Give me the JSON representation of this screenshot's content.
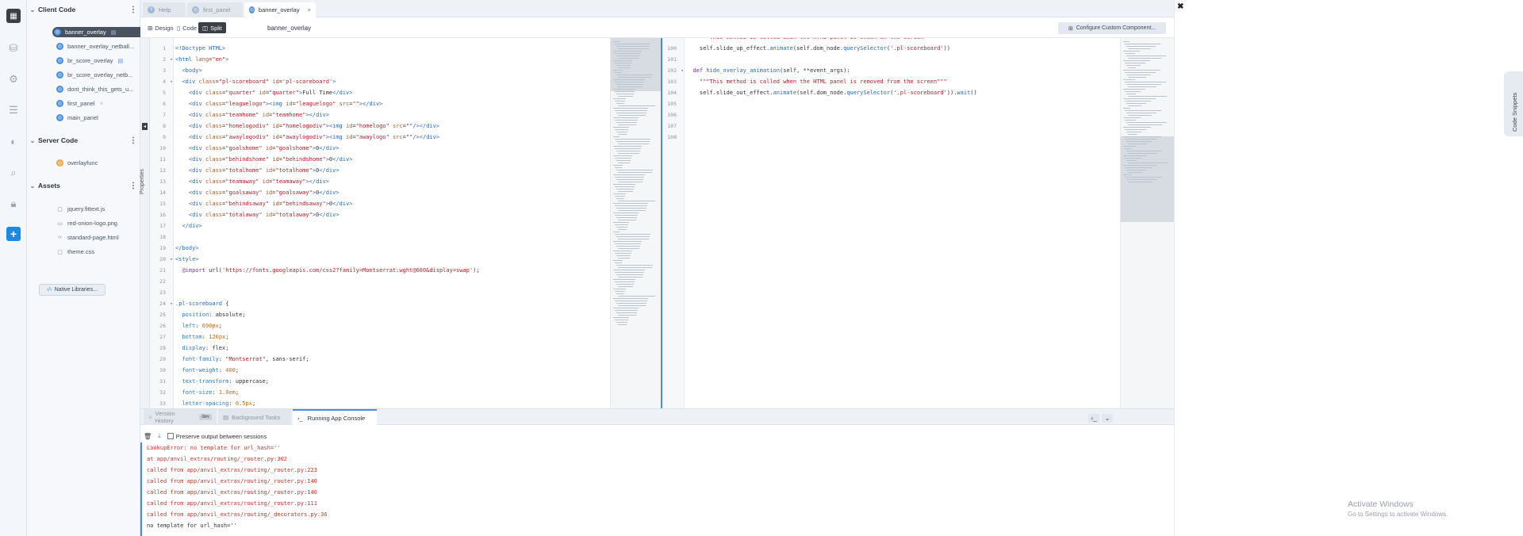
{
  "sidebar": {
    "client_code": {
      "title": "Client Code",
      "items": [
        {
          "label": "banner_overlay",
          "active": true
        },
        {
          "label": "banner_overlay_netball..."
        },
        {
          "label": "br_score_overlay"
        },
        {
          "label": "br_score_overlay_netb..."
        },
        {
          "label": "dont_think_this_gets_u..."
        },
        {
          "label": "first_panel"
        },
        {
          "label": "main_panel"
        }
      ]
    },
    "server_code": {
      "title": "Server Code",
      "items": [
        {
          "label": "overlayfunc"
        }
      ]
    },
    "assets": {
      "title": "Assets",
      "items": [
        {
          "label": "jquery.fittext.js"
        },
        {
          "label": "red-onion-logo.png"
        },
        {
          "label": "standard-page.html"
        },
        {
          "label": "theme.css"
        }
      ]
    },
    "native_libraries_label": "Native Libraries..."
  },
  "tabs": [
    {
      "label": "Help"
    },
    {
      "label": "first_panel"
    },
    {
      "label": "banner_overlay",
      "active": true
    }
  ],
  "toolbar": {
    "design_label": "Design",
    "code_label": "Code",
    "split_label": "Split",
    "file_name": "banner_overlay",
    "configure_label": "Configure Custom Component...",
    "properties_label": "Properties"
  },
  "html_editor": {
    "lines": [
      {
        "n": "1",
        "fold": "",
        "html": "<span class=\"t\">&lt;!Doctype HTML&gt;</span>"
      },
      {
        "n": "2",
        "fold": "▾",
        "html": "<span class=\"t\">&lt;html</span> <span class=\"a\">lang</span>=<span class=\"s\">\"en\"</span><span class=\"t\">&gt;</span>"
      },
      {
        "n": "3",
        "fold": "",
        "html": "  <span class=\"t\">&lt;body&gt;</span>"
      },
      {
        "n": "4",
        "fold": "▾",
        "html": "  <span class=\"t\">&lt;div</span> <span class=\"a\">class</span>=<span class=\"s\">\"pl-scoreboard\"</span> <span class=\"a\">id</span>=<span class=\"s\">'pl-scoreboard'</span><span class=\"t\">&gt;</span>"
      },
      {
        "n": "5",
        "fold": "",
        "html": "    <span class=\"t\">&lt;div</span> <span class=\"a\">class</span>=<span class=\"s\">\"quarter\"</span> <span class=\"a\">id</span>=<span class=\"s\">\"quarter\"</span><span class=\"t\">&gt;</span>Full Time<span class=\"t\">&lt;/div&gt;</span>"
      },
      {
        "n": "6",
        "fold": "",
        "html": "    <span class=\"t\">&lt;div</span> <span class=\"a\">class</span>=<span class=\"s\">\"leaguelogo\"</span><span class=\"t\">&gt;&lt;img</span> <span class=\"a\">id</span>=<span class=\"s\">\"leaguelogo\"</span> <span class=\"a\">src</span>=<span class=\"s\">\"\"</span><span class=\"t\">&gt;&lt;/div&gt;</span>"
      },
      {
        "n": "7",
        "fold": "",
        "html": "    <span class=\"t\">&lt;div</span> <span class=\"a\">class</span>=<span class=\"s\">\"teamhome\"</span> <span class=\"a\">id</span>=<span class=\"s\">\"teamhome\"</span><span class=\"t\">&gt;&lt;/div&gt;</span>"
      },
      {
        "n": "8",
        "fold": "",
        "html": "    <span class=\"t\">&lt;div</span> <span class=\"a\">class</span>=<span class=\"s\">\"homelogodiv\"</span> <span class=\"a\">id</span>=<span class=\"s\">\"homelogodiv\"</span><span class=\"t\">&gt;&lt;img</span> <span class=\"a\">id</span>=<span class=\"s\">\"homelogo\"</span> <span class=\"a\">src</span>=<span class=\"s\">\"\"</span><span class=\"t\">/&gt;&lt;/div&gt;</span>"
      },
      {
        "n": "9",
        "fold": "",
        "html": "    <span class=\"t\">&lt;div</span> <span class=\"a\">class</span>=<span class=\"s\">\"awaylogodiv\"</span> <span class=\"a\">id</span>=<span class=\"s\">\"awaylogodiv\"</span><span class=\"t\">&gt;&lt;img</span> <span class=\"a\">id</span>=<span class=\"s\">\"awaylogo\"</span> <span class=\"a\">src</span>=<span class=\"s\">\"\"</span><span class=\"t\">/&gt;&lt;/div&gt;</span>"
      },
      {
        "n": "10",
        "fold": "",
        "html": "    <span class=\"t\">&lt;div</span> <span class=\"a\">class</span>=<span class=\"s\">\"goalshome\"</span> <span class=\"a\">id</span>=<span class=\"s\">\"goalshome\"</span><span class=\"t\">&gt;</span>0<span class=\"t\">&lt;/div&gt;</span>"
      },
      {
        "n": "11",
        "fold": "",
        "html": "    <span class=\"t\">&lt;div</span> <span class=\"a\">class</span>=<span class=\"s\">\"behindshome\"</span> <span class=\"a\">id</span>=<span class=\"s\">\"behindshome\"</span><span class=\"t\">&gt;</span>0<span class=\"t\">&lt;/div&gt;</span>"
      },
      {
        "n": "12",
        "fold": "",
        "html": "    <span class=\"t\">&lt;div</span> <span class=\"a\">class</span>=<span class=\"s\">\"totalhome\"</span> <span class=\"a\">id</span>=<span class=\"s\">\"totalhome\"</span><span class=\"t\">&gt;</span>0<span class=\"t\">&lt;/div&gt;</span>"
      },
      {
        "n": "13",
        "fold": "",
        "html": "    <span class=\"t\">&lt;div</span> <span class=\"a\">class</span>=<span class=\"s\">\"teamaway\"</span> <span class=\"a\">id</span>=<span class=\"s\">\"teamaway\"</span><span class=\"t\">&gt;&lt;/div&gt;</span>"
      },
      {
        "n": "14",
        "fold": "",
        "html": "    <span class=\"t\">&lt;div</span> <span class=\"a\">class</span>=<span class=\"s\">\"goalsaway\"</span> <span class=\"a\">id</span>=<span class=\"s\">\"goalsaway\"</span><span class=\"t\">&gt;</span>0<span class=\"t\">&lt;/div&gt;</span>"
      },
      {
        "n": "15",
        "fold": "",
        "html": "    <span class=\"t\">&lt;div</span> <span class=\"a\">class</span>=<span class=\"s\">\"behindsaway\"</span> <span class=\"a\">id</span>=<span class=\"s\">\"behindsaway\"</span><span class=\"t\">&gt;</span>0<span class=\"t\">&lt;/div&gt;</span>"
      },
      {
        "n": "16",
        "fold": "",
        "html": "    <span class=\"t\">&lt;div</span> <span class=\"a\">class</span>=<span class=\"s\">\"totalaway\"</span> <span class=\"a\">id</span>=<span class=\"s\">\"totalaway\"</span><span class=\"t\">&gt;</span>0<span class=\"t\">&lt;/div&gt;</span>"
      },
      {
        "n": "17",
        "fold": "",
        "html": "  <span class=\"t\">&lt;/div&gt;</span>"
      },
      {
        "n": "18",
        "fold": "",
        "html": ""
      },
      {
        "n": "19",
        "fold": "",
        "html": "<span class=\"t\">&lt;/body&gt;</span>"
      },
      {
        "n": "20",
        "fold": "▾",
        "html": "<span class=\"t\">&lt;style&gt;</span>"
      },
      {
        "n": "21",
        "fold": "",
        "html": "  <span class=\"k\">@import</span> url(<span class=\"s\">'https://fonts.googleapis.com/css2?family=Montserrat:wght@600&amp;display=swap'</span>);"
      },
      {
        "n": "22",
        "fold": "",
        "html": ""
      },
      {
        "n": "23",
        "fold": "",
        "html": ""
      },
      {
        "n": "24",
        "fold": "▾",
        "html": "<span class=\"t\">.pl-scoreboard</span> {"
      },
      {
        "n": "25",
        "fold": "",
        "html": "  <span class=\"p\">position</span>: absolute;"
      },
      {
        "n": "26",
        "fold": "",
        "html": "  <span class=\"p\">left</span>: <span class=\"n\">690px</span>;"
      },
      {
        "n": "27",
        "fold": "",
        "html": "  <span class=\"p\">bottom</span>: <span class=\"n\">126px</span>;"
      },
      {
        "n": "28",
        "fold": "",
        "html": "  <span class=\"p\">display</span>: flex;"
      },
      {
        "n": "29",
        "fold": "",
        "html": "  <span class=\"p\">font-family</span>: <span class=\"s\">\"Montserrat\"</span>, sans-serif;"
      },
      {
        "n": "30",
        "fold": "",
        "html": "  <span class=\"p\">font-weight</span>: <span class=\"n\">400</span>;"
      },
      {
        "n": "31",
        "fold": "",
        "html": "  <span class=\"p\">text-transform</span>: uppercase;"
      },
      {
        "n": "32",
        "fold": "",
        "html": "  <span class=\"p\">font-size</span>: <span class=\"n\">1.0em</span>;"
      },
      {
        "n": "33",
        "fold": "",
        "html": "  <span class=\"p\">letter-spacing</span>: <span class=\"n\">0.5px</span>;"
      }
    ]
  },
  "py_editor": {
    "lines": [
      {
        "n": "",
        "fold": "",
        "html": "    <span class=\"s\">\"\"\"This method is called when the HTML panel is shown on the screen\"\"\"</span>"
      },
      {
        "n": "100",
        "fold": "",
        "html": "    self.slide_up_effect.<span class=\"t\">animate</span>(self.dom_node.<span class=\"t\">querySelector</span>(<span class=\"s\">'.pl-scoreboard'</span>))"
      },
      {
        "n": "101",
        "fold": "",
        "html": ""
      },
      {
        "n": "102",
        "fold": "▾",
        "html": "  <span class=\"k\">def</span> <span class=\"t\">hide_overlay_animation</span>(self, **event_args):"
      },
      {
        "n": "103",
        "fold": "",
        "html": "    <span class=\"s\">\"\"\"This method is called when the HTML panel is removed from the screen\"\"\"</span>"
      },
      {
        "n": "104",
        "fold": "",
        "html": "    self.slide_out_effect.<span class=\"t\">animate</span>(self.dom_node.<span class=\"t\">querySelector</span>(<span class=\"s\">'.pl-scoreboard'</span>)).<span class=\"t\">wait</span>()"
      },
      {
        "n": "105",
        "fold": "",
        "html": ""
      },
      {
        "n": "106",
        "fold": "",
        "html": ""
      },
      {
        "n": "107",
        "fold": "",
        "html": ""
      },
      {
        "n": "108",
        "fold": "",
        "html": ""
      }
    ]
  },
  "bottom_panel": {
    "tabs": [
      {
        "label": "Version History",
        "badge": "dev"
      },
      {
        "label": "Background Tasks"
      },
      {
        "label": "Running App Console",
        "active": true
      }
    ],
    "preserve_label": "Preserve output between sessions",
    "console_lines": [
      {
        "text": "LookupError: no template for url_hash=''",
        "error": true
      },
      {
        "text": "at app/anvil_extras/routing/_router.py:302",
        "error": true
      },
      {
        "text": "called from app/anvil_extras/routing/_router.py:223",
        "error": true
      },
      {
        "text": "called from app/anvil_extras/routing/_router.py:140",
        "error": true
      },
      {
        "text": "called from app/anvil_extras/routing/_router.py:140",
        "error": true
      },
      {
        "text": "called from app/anvil_extras/routing/_router.py:111",
        "error": true
      },
      {
        "text": "called from app/anvil_extras/routing/_decorators.py:36",
        "error": true
      },
      {
        "text": "no template for url_hash=''",
        "error": false
      }
    ]
  },
  "code_snippets_label": "Code Snippets",
  "watermark": {
    "line1": "Activate Windows",
    "line2": "Go to Settings to activate Windows."
  },
  "icons": {
    "rail": [
      "app-logo-icon",
      "database-icon",
      "settings-icon",
      "list-icon",
      "palette-icon",
      "search-icon",
      "lock-icon",
      "add-icon"
    ]
  }
}
